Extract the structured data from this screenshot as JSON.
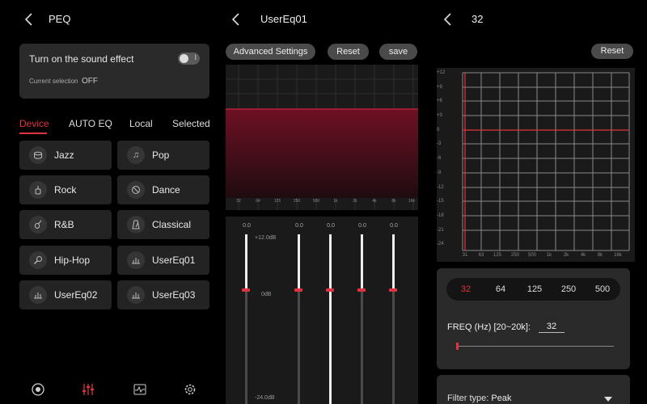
{
  "panel1": {
    "title": "PEQ",
    "sound_effect_label": "Turn on the sound effect",
    "toggle_mark": "I",
    "current_selection_label": "Current selection",
    "current_selection_value": "OFF",
    "tabs": [
      "Device",
      "AUTO EQ",
      "Local",
      "Selected"
    ],
    "presets": [
      {
        "label": "Jazz",
        "icon": "drum-icon"
      },
      {
        "label": "Pop",
        "icon": "music-note-icon"
      },
      {
        "label": "Rock",
        "icon": "guitar-icon"
      },
      {
        "label": "Dance",
        "icon": "disc-icon"
      },
      {
        "label": "R&B",
        "icon": "violin-icon"
      },
      {
        "label": "Classical",
        "icon": "metronome-icon"
      },
      {
        "label": "Hip-Hop",
        "icon": "microphone-icon"
      },
      {
        "label": "UserEq01",
        "icon": "user-eq-icon"
      },
      {
        "label": "UserEq02",
        "icon": "user-eq-icon"
      },
      {
        "label": "UserEq03",
        "icon": "user-eq-icon"
      }
    ],
    "nav": [
      "record-icon",
      "equalizer-icon",
      "waveform-icon",
      "settings-icon"
    ]
  },
  "panel2": {
    "title": "UserEq01",
    "buttons": {
      "advanced": "Advanced Settings",
      "reset": "Reset",
      "save": "save"
    },
    "chart_x_labels": [
      "32",
      "64",
      "125",
      "250",
      "500",
      "1k",
      "2k",
      "4k",
      "8k",
      "16k"
    ],
    "slider_values": [
      "0.0",
      "0.0",
      "0.0",
      "0.0",
      "0.0"
    ],
    "db_top": "+12.0dB",
    "db_mid": "0dB",
    "db_bottom": "-24.0dB"
  },
  "panel3": {
    "title": "32",
    "reset": "Reset",
    "y_labels": [
      "+12",
      "+9",
      "+6",
      "+3",
      "0",
      "-3",
      "-6",
      "-9",
      "-12",
      "-15",
      "-18",
      "-21",
      "-24"
    ],
    "x_labels": [
      "31",
      "63",
      "125",
      "250",
      "500",
      "1k",
      "2k",
      "4k",
      "8k",
      "16k"
    ],
    "freq_tabs": [
      "32",
      "64",
      "125",
      "250",
      "500"
    ],
    "freq_label": "FREQ (Hz) [20~20k]:",
    "freq_value": "32",
    "filter_label": "Filter type:",
    "filter_value": "Peak"
  },
  "colors": {
    "accent": "#e0333f",
    "card": "#2a2a2a",
    "bg": "#000000"
  }
}
